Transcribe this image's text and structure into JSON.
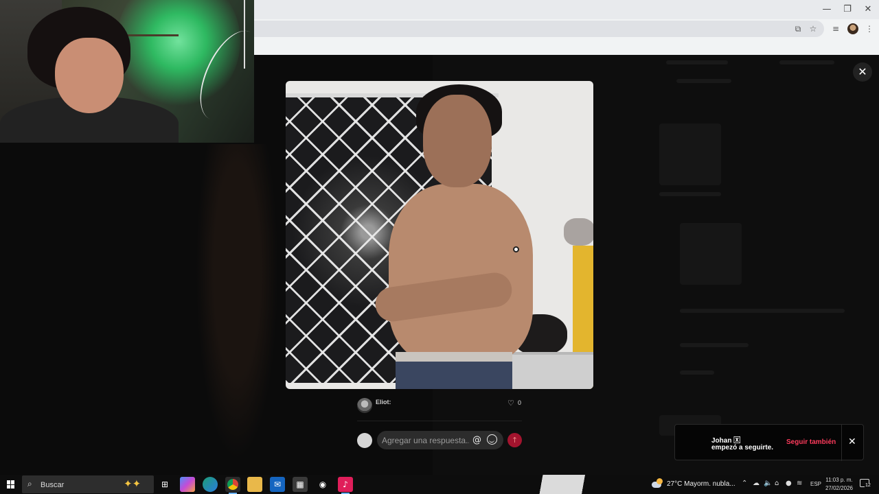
{
  "post": {
    "author": "Eliot:",
    "likes": "0"
  },
  "reply": {
    "placeholder": "Agregar una respuesta..."
  },
  "toast": {
    "name": "Johan 🅇",
    "text": "empezó a seguirte.",
    "action": "Seguir también"
  },
  "taskbar": {
    "search_label": "Buscar",
    "weather": "27°C  Mayorm. nubla...",
    "language": "ESP",
    "time": "11:03 p. m.",
    "date": "27/02/2026",
    "notifications": "12"
  },
  "colors": {
    "accent": "#ff3b5c",
    "send_button": "#a3142e",
    "modal_bg": "#050505"
  }
}
